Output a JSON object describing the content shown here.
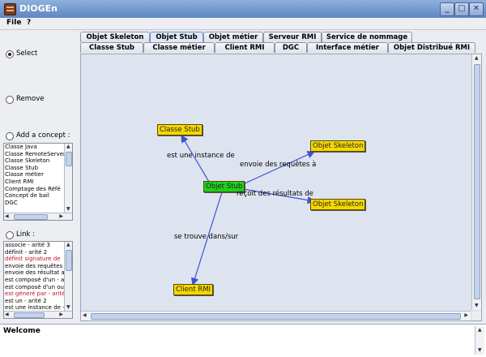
{
  "window": {
    "title": "DIOGEn"
  },
  "menu": [
    {
      "label": "File"
    },
    {
      "label": "?"
    }
  ],
  "modes": {
    "select": "Select",
    "remove": "Remove",
    "add_concept": "Add a concept :",
    "link": "Link :"
  },
  "concepts": [
    "Classe Java",
    "Classe RemoteServer",
    "Classe Skeleton",
    "Classe Stub",
    "Classe métier",
    "Client RMI",
    "Comptage des Réfé",
    "Concept de bail",
    "DGC"
  ],
  "links": [
    {
      "text": "associe - arité 3",
      "red": false
    },
    {
      "text": "définit - arité 2",
      "red": false
    },
    {
      "text": "définit signature de",
      "red": true
    },
    {
      "text": "envoie des requêtes",
      "red": false
    },
    {
      "text": "envoie des résultat a",
      "red": false
    },
    {
      "text": "est composé d'un - a",
      "red": false
    },
    {
      "text": "est composé d'un ou",
      "red": false
    },
    {
      "text": "est géneré par - arité",
      "red": true
    },
    {
      "text": "est un - arité 2",
      "red": false
    },
    {
      "text": "est une instance de -",
      "red": false
    }
  ],
  "tabs_row1": [
    {
      "label": "Objet Skeleton",
      "active": false
    },
    {
      "label": "Objet Stub",
      "active": true
    },
    {
      "label": "Objet métier",
      "active": false
    },
    {
      "label": "Serveur RMI",
      "active": false
    },
    {
      "label": "Service de nommage",
      "active": false
    }
  ],
  "tabs_row2": [
    {
      "label": "Classe Stub"
    },
    {
      "label": "Classe métier"
    },
    {
      "label": "Client RMI"
    },
    {
      "label": "DGC"
    },
    {
      "label": "Interface métier"
    },
    {
      "label": "Objet Distribué RMI"
    }
  ],
  "graph": {
    "center": {
      "label": "Objet Stub",
      "color": "#1ed11e"
    },
    "nodes": [
      {
        "label": "Classe Stub",
        "color": "#f5d800"
      },
      {
        "label": "Objet Skeleton",
        "color": "#f5d800"
      },
      {
        "label": "Objet Skeleton",
        "color": "#f5d800"
      },
      {
        "label": "Client RMI",
        "color": "#f5d800"
      }
    ],
    "edges": [
      {
        "label": "est une instance de"
      },
      {
        "label": "envoie des requêtes à"
      },
      {
        "label": "reçoit des résultats de"
      },
      {
        "label": "se trouve dans/sur"
      }
    ]
  },
  "status": {
    "message": "Welcome"
  },
  "colors": {
    "edge": "#3f4fd6",
    "node_yellow": "#f5d800",
    "node_green": "#1ed11e",
    "canvas_bg": "#dde4ef"
  }
}
